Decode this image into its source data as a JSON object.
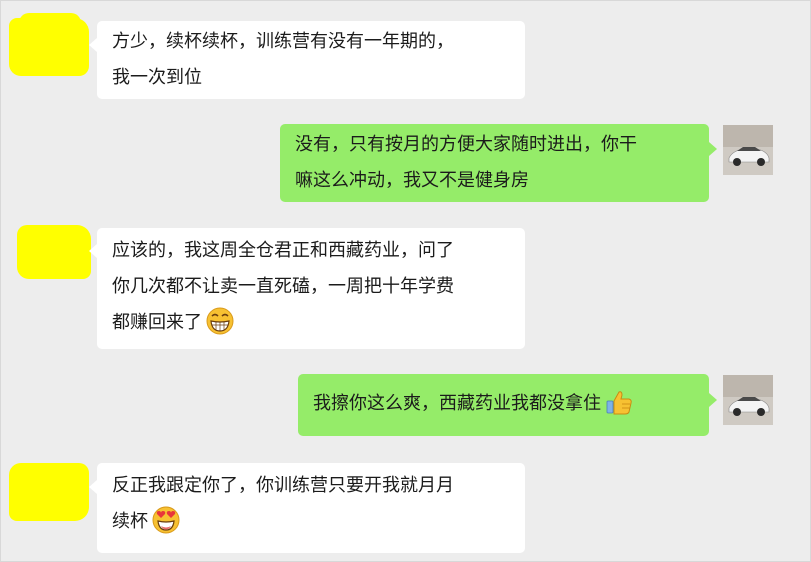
{
  "messages": [
    {
      "side": "left",
      "lines": [
        "方少，续杯续杯，训练营有没有一年期的，",
        "我一次到位"
      ]
    },
    {
      "side": "right",
      "lines": [
        "没有，只有按月的方便大家随时进出，你干",
        "嘛这么冲动，我又不是健身房"
      ]
    },
    {
      "side": "left",
      "lines": [
        "应该的，我这周全仓君正和西藏药业，问了",
        "你几次都不让卖一直死磕，一周把十年学费",
        "都赚回来了"
      ],
      "emoji": "grinning-emoji"
    },
    {
      "side": "right",
      "lines": [
        "我擦你这么爽，西藏药业我都没拿住"
      ],
      "emoji": "thumbs-up-emoji"
    },
    {
      "side": "left",
      "lines": [
        "反正我跟定你了，你训练营只要开我就月月",
        "续杯"
      ],
      "emoji": "heart-eyes-emoji"
    }
  ],
  "colors": {
    "background": "#ededed",
    "left_bubble": "#ffffff",
    "right_bubble": "#95ec69",
    "redaction": "#ffff00"
  }
}
